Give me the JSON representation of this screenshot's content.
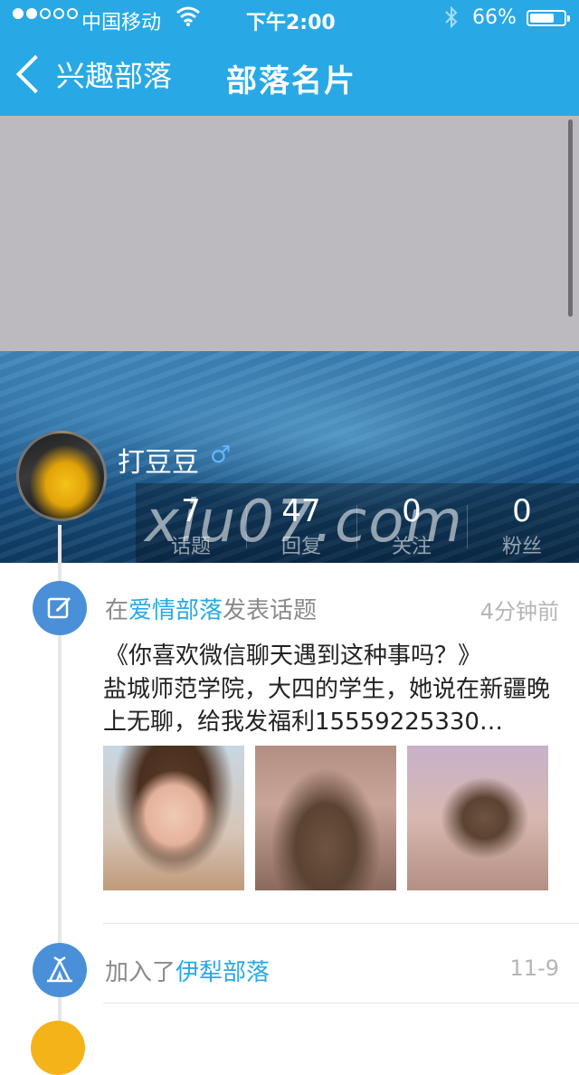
{
  "status_bar": {
    "carrier": "中国移动",
    "time": "下午2:00",
    "battery": "66%"
  },
  "nav": {
    "back_label": "兴趣部落",
    "title": "部落名片"
  },
  "profile": {
    "name": "打豆豆",
    "gender_symbol": "♂",
    "stats": [
      {
        "value": "7",
        "label": "话题"
      },
      {
        "value": "47",
        "label": "回复"
      },
      {
        "value": "0",
        "label": "关注"
      },
      {
        "value": "0",
        "label": "粉丝"
      }
    ]
  },
  "watermark": "xiu07.com",
  "feed": {
    "post": {
      "prefix": "在",
      "tribe": "爱情部落",
      "suffix": "发表话题",
      "time": "4分钟前",
      "title": "《你喜欢微信聊天遇到这种事吗？》",
      "body": "盐城师范学院，大四的学生，她说在新疆晚上无聊，给我发福利15559225330…"
    },
    "join": {
      "prefix": "加入了",
      "tribe": "伊犁部落",
      "time": "11-9"
    }
  },
  "colors": {
    "accent": "#28a9e6",
    "timeline_icon": "#4a90d9"
  },
  "icons": [
    "wifi-icon",
    "bluetooth-icon",
    "battery-icon",
    "back-chevron-icon",
    "male-icon",
    "edit-icon",
    "tent-icon"
  ]
}
